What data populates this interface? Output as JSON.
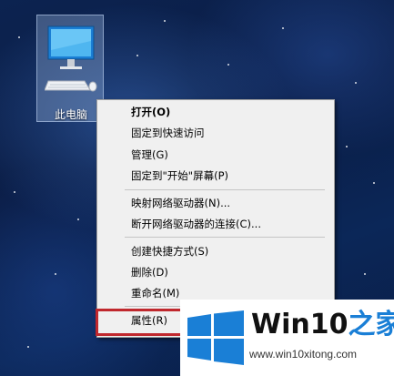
{
  "desktop": {
    "icon": {
      "label": "此电脑",
      "icon_name": "this-pc-icon"
    }
  },
  "context_menu": {
    "items": [
      {
        "label": "打开(O)",
        "bold": true
      },
      {
        "label": "固定到快速访问"
      },
      {
        "label": "管理(G)"
      },
      {
        "label": "固定到\"开始\"屏幕(P)"
      },
      {
        "label": "映射网络驱动器(N)..."
      },
      {
        "label": "断开网络驱动器的连接(C)..."
      },
      {
        "label": "创建快捷方式(S)"
      },
      {
        "label": "删除(D)"
      },
      {
        "label": "重命名(M)"
      },
      {
        "label": "属性(R)"
      }
    ]
  },
  "watermark": {
    "brand_prefix": "Win10",
    "brand_suffix": "之家",
    "url": "www.win10xitong.com",
    "accent_color": "#1a7fd6"
  },
  "colors": {
    "highlight": "#c0282d",
    "menu_bg": "#f0f0f0"
  }
}
